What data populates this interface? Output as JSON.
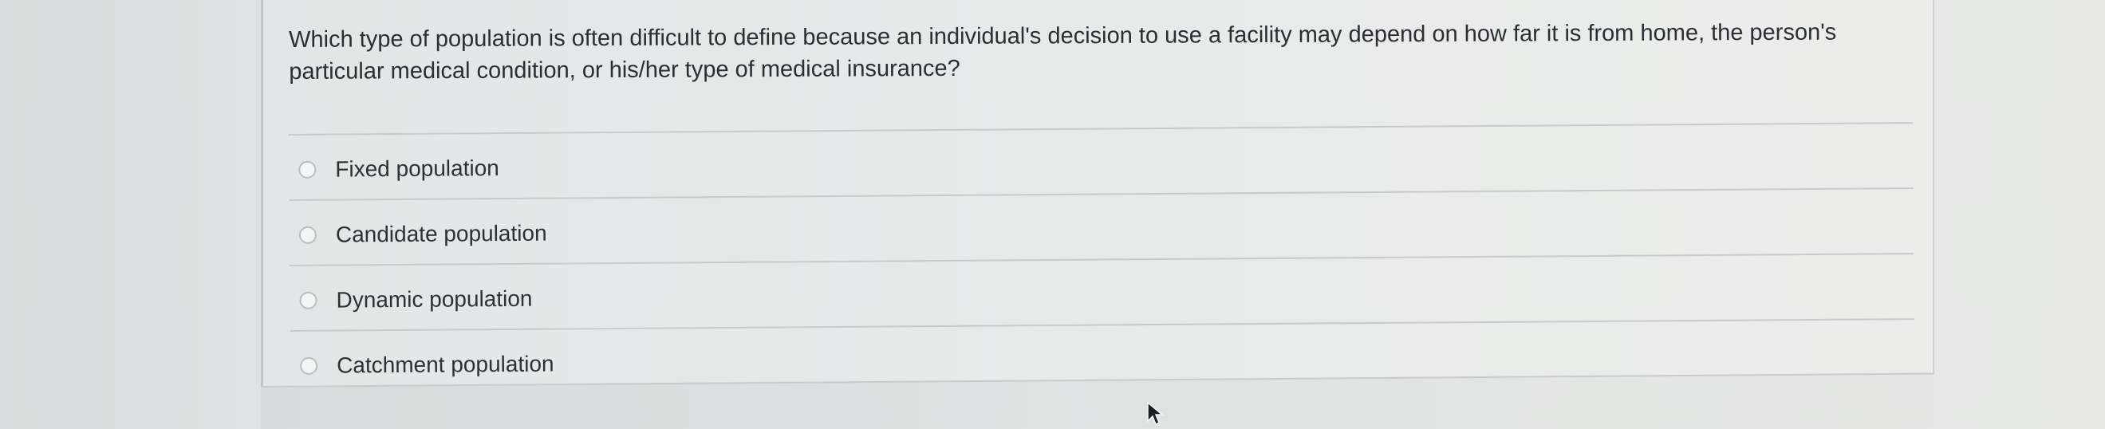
{
  "question": {
    "text": "Which type of population is often difficult to define because an individual's decision to use a facility may depend on how far it is from home, the person's particular medical condition, or his/her type of medical insurance?"
  },
  "options": [
    {
      "label": "Fixed population",
      "selected": false
    },
    {
      "label": "Candidate population",
      "selected": false
    },
    {
      "label": "Dynamic population",
      "selected": false
    },
    {
      "label": "Catchment population",
      "selected": false
    }
  ],
  "colors": {
    "text": "#2b2f34",
    "divider": "#c7cbcc",
    "background": "#e3e6e6"
  },
  "icons": {
    "cursor": "mouse-pointer-icon",
    "radio": "radio-button"
  }
}
